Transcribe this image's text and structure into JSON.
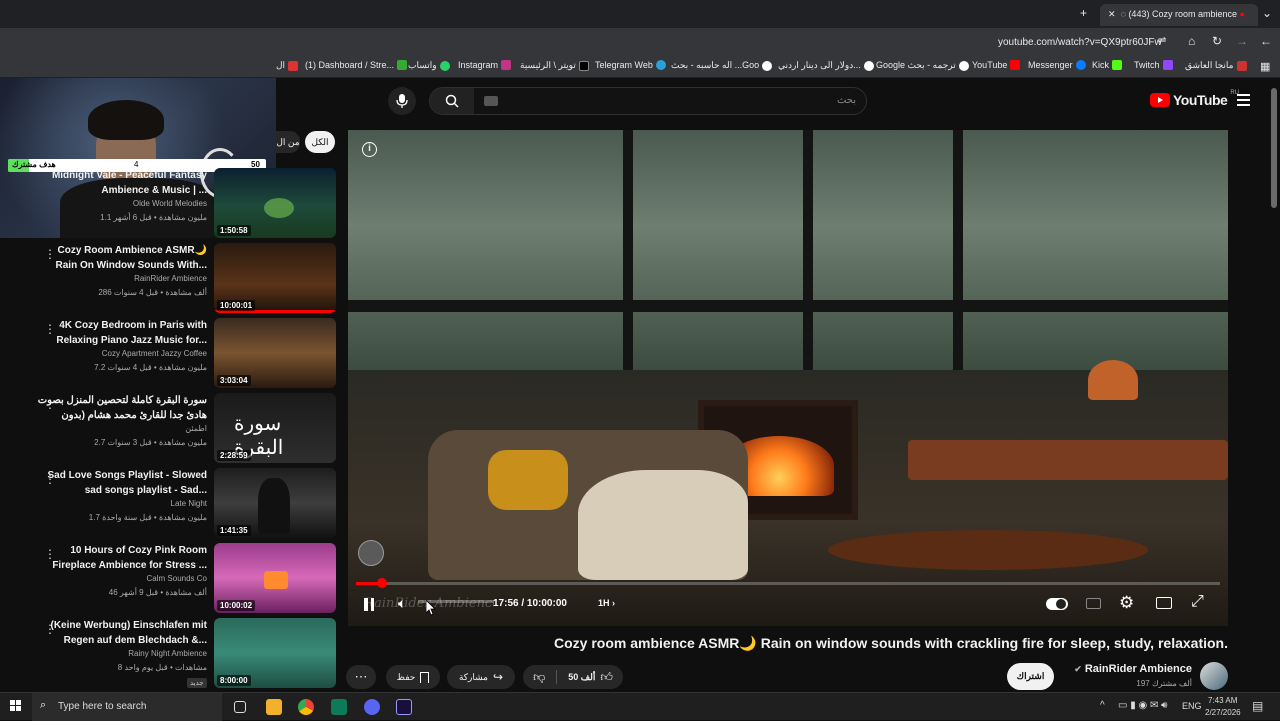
{
  "browser": {
    "tab_title": "(443) Cozy room ambience",
    "url": "youtube.com/watch?v=QX9ptr60JFw",
    "bookmarks": [
      "ال",
      "(1) Dashboard / Stre...",
      "واتساب",
      "Instagram",
      "تويتر \\ الرئيسية",
      "Telegram Web",
      "اله حاسبه - بحث ...Goo",
      "دولار الى دينار اردني...",
      "Google ترجمه - بحث",
      "YouTube",
      "Messenger",
      "Kick",
      "Twitch",
      "مانجا العاشق"
    ]
  },
  "overlay": {
    "goal_label": "هدف مشترك",
    "goal_current": "4",
    "goal_target": "50"
  },
  "youtube": {
    "search_placeholder": "بحث",
    "region": "RU",
    "logo_text": "YouTube",
    "chips": [
      "الكل",
      "من ال"
    ]
  },
  "sidebar_videos": [
    {
      "title": "Midnight Vale - Peaceful Fantasy Ambience & Music | ...",
      "channel": "Olde World Melodies",
      "meta": "1.1 مليون مشاهدة • قبل 6 أشهر",
      "duration": "1:50:58"
    },
    {
      "title": "Cozy Room Ambience ASMR🌙 Rain On Window Sounds With...",
      "channel": "RainRider Ambience",
      "meta": "286 ألف مشاهدة • قبل 4 سنوات",
      "duration": "10:00:01"
    },
    {
      "title": "4K Cozy Bedroom in Paris with Relaxing Piano Jazz Music for...",
      "channel": "Cozy Apartment  Jazzy Coffee",
      "meta": "7.2 مليون مشاهدة • قبل 4 سنوات",
      "duration": "3:03:04"
    },
    {
      "title": "سورة البقرة كاملة لتحصين المنزل بصوت هادئ جدا للقارئ محمد هشام (بدون اعلانات)",
      "channel": "اطمئن",
      "meta": "2.7 مليون مشاهدة • قبل 3 سنوات",
      "duration": "2:28:59"
    },
    {
      "title": "Sad Love Songs Playlist - Slowed sad songs playlist - Sad...",
      "channel": "Late Night",
      "meta": "1.7 مليون مشاهدة • قبل سنة واحدة",
      "duration": "1:41:35"
    },
    {
      "title": "10 Hours of Cozy Pink Room Fireplace Ambience for Stress ...",
      "channel": "Calm Sounds Co",
      "meta": "46 ألف مشاهدة • قبل 9 أشهر",
      "duration": "10:00:02"
    },
    {
      "title": "(Keine Werbung) Einschlafen mit Regen auf dem Blechdach &...",
      "channel": "Rainy Night Ambience",
      "meta": "8 مشاهدات • قبل يوم واحد",
      "duration": "8:00:00",
      "badge": "جديد"
    }
  ],
  "player": {
    "time_current": "17:56",
    "time_total": "10:00:00",
    "chapter": "1H",
    "progress": 0.03,
    "watermark": "RainRider Ambience"
  },
  "video": {
    "title": "Cozy room ambience ASMR🌙 Rain on window sounds with crackling fire for sleep, study, relaxation.",
    "channel": "RainRider Ambience",
    "subscribers": "197 ألف مشترك",
    "subscribe_label": "اشتراك",
    "likes": "50 ألف",
    "share_label": "مشاركة",
    "save_label": "حفظ"
  },
  "taskbar": {
    "search_placeholder": "Type here to search",
    "lang": "ENG",
    "time": "7:43 AM",
    "date": "2/27/2026"
  },
  "colors": {
    "youtube_red": "#ff0000",
    "bg": "#0f0f0f",
    "chip": "#272727"
  }
}
